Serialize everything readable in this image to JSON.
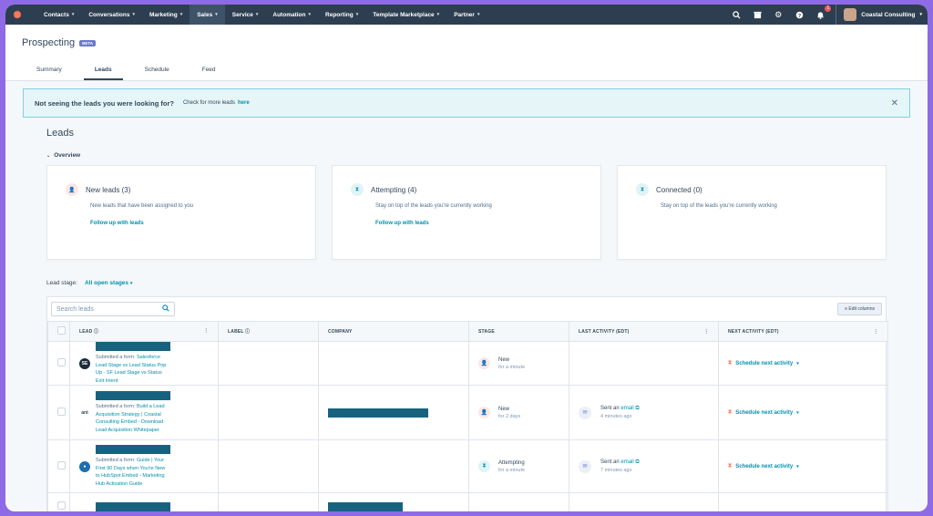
{
  "nav": {
    "items": [
      "Contacts",
      "Conversations",
      "Marketing",
      "Sales",
      "Service",
      "Automation",
      "Reporting",
      "Template Marketplace",
      "Partner"
    ],
    "active": "Sales",
    "notifications_count": "1",
    "account": "Coastal Consulting"
  },
  "page": {
    "title": "Prospecting",
    "beta": "BETA",
    "tabs": [
      "Summary",
      "Leads",
      "Schedule",
      "Feed"
    ],
    "active_tab": "Leads"
  },
  "alert": {
    "strong": "Not seeing the leads you were looking for?",
    "text": "Check for more leads",
    "link": "here"
  },
  "leads": {
    "heading": "Leads",
    "overview_label": "Overview",
    "cards": [
      {
        "title": "New leads (3)",
        "desc": "New leads that have been assigned to you",
        "link": "Follow up with leads"
      },
      {
        "title": "Attempting (4)",
        "desc": "Stay on top of the leads you're currently working",
        "link": "Follow up with leads"
      },
      {
        "title": "Connected (0)",
        "desc": "Stay on top of the leads you're currently working",
        "link": ""
      }
    ],
    "stage_label": "Lead stage:",
    "stage_value": "All open stages",
    "search_placeholder": "Search leads",
    "edit_columns": "Edit columns",
    "columns": [
      "LEAD",
      "LABEL",
      "COMPANY",
      "STAGE",
      "LAST ACTIVITY (EDT)",
      "NEXT ACTIVITY (EDT)"
    ],
    "rows": [
      {
        "sub_prefix": "Submitted a form:",
        "sub": "Salesforce Lead Stage vs Lead Status Pop Up - SF Lead Stage vs Status Exit Intent",
        "stage": "New",
        "stage_time": "for a minute",
        "activity": "",
        "activity_link": "",
        "activity_time": "",
        "next": "Schedule next activity"
      },
      {
        "sub_prefix": "Submitted a form:",
        "sub": "Build a Lead Acquisition Strategy | Coastal Consulting Embed - Download Lead Acquisition Whitepaper",
        "stage": "New",
        "stage_time": "for 2 days",
        "activity": "Sent an",
        "activity_link": "email",
        "activity_time": "4 minutes ago",
        "next": "Schedule next activity"
      },
      {
        "sub_prefix": "Submitted a form:",
        "sub": "Guide | Your First 90 Days when You're New to HubSpot Embed - Marketing Hub Activation Guide",
        "stage": "Attempting",
        "stage_time": "for a minute",
        "activity": "Sent an",
        "activity_link": "email",
        "activity_time": "7 minutes ago",
        "next": "Schedule next activity"
      }
    ]
  },
  "colors": {
    "nav_bg": "#2d3e50",
    "accent": "#0091ae",
    "orange": "#ff7a59",
    "frame": "#8f6ae6"
  }
}
